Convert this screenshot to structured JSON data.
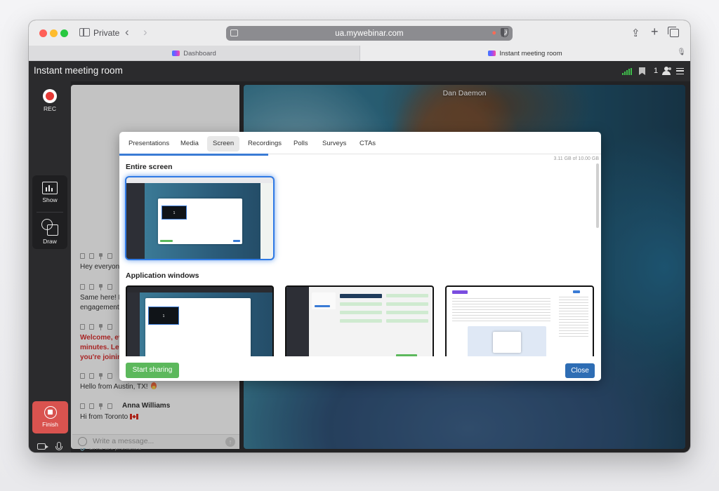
{
  "browser": {
    "mode_label": "Private",
    "url": "ua.mywebinar.com",
    "tabs": [
      {
        "label": "Dashboard"
      },
      {
        "label": "Instant meeting room"
      }
    ]
  },
  "app": {
    "title": "Instant meeting room",
    "participants_count": "1"
  },
  "rail": {
    "rec_label": "REC",
    "show_label": "Show",
    "draw_label": "Draw",
    "finish_label": "Finish"
  },
  "chat": {
    "messages": [
      {
        "author": "",
        "text": "Hey everyone!"
      },
      {
        "author": "",
        "text": "Same here! Lo"
      },
      {
        "author": "",
        "text": "engagement."
      },
      {
        "author": "",
        "text": "Welcome, ev"
      },
      {
        "author": "",
        "text": "minutes. Let"
      },
      {
        "author": "",
        "text": "you're joinin"
      },
      {
        "author": "",
        "text": "Hello from Austin, TX!"
      },
      {
        "author": "Anna Williams",
        "text": "Hi from Toronto"
      }
    ],
    "links_note": "Links are prohibited",
    "input_placeholder": "Write a message..."
  },
  "stage": {
    "presenter_name": "Dan Daemon"
  },
  "modal": {
    "tabs": [
      {
        "label": "Presentations"
      },
      {
        "label": "Media"
      },
      {
        "label": "Screen"
      },
      {
        "label": "Recordings"
      },
      {
        "label": "Polls"
      },
      {
        "label": "Surveys"
      },
      {
        "label": "CTAs"
      }
    ],
    "active_tab": "Screen",
    "storage_text": "3.11 GB of 10.00 GB",
    "storage_used_fraction": 0.311,
    "entire_screen_title": "Entire screen",
    "application_windows_title": "Application windows",
    "thumb_screen_number": "1",
    "start_button": "Start sharing",
    "close_button": "Close"
  },
  "colors": {
    "accent_blue": "#2e6db4",
    "start_green": "#5cb85c",
    "finish_red": "#d9534f",
    "alert_red": "#d32f2f"
  }
}
